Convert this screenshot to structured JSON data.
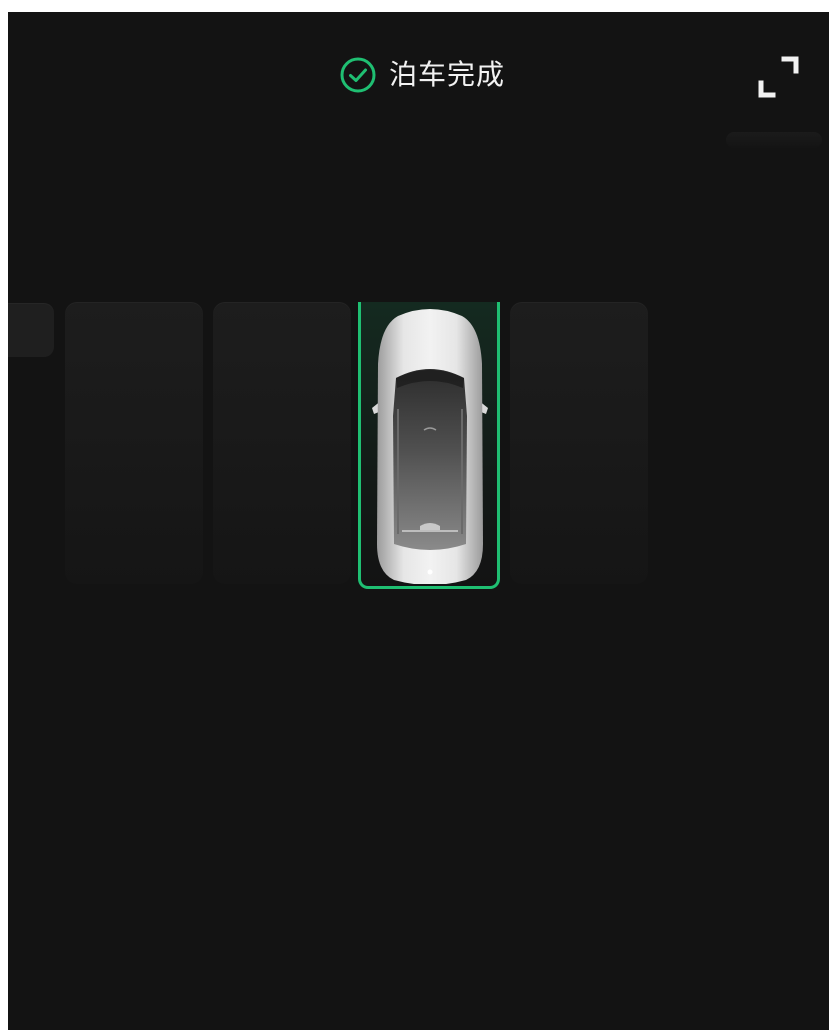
{
  "header": {
    "status_text": "泊车完成",
    "status_icon": "check-circle-icon",
    "expand_icon": "expand-icon"
  },
  "colors": {
    "accent": "#1fbf72",
    "background": "#131313",
    "slot": "#1b1b1b",
    "text": "#f2f2f2"
  },
  "parking": {
    "slot_count": 5,
    "occupied_slot": 4,
    "vehicle_icon": "car-top-view-icon"
  }
}
